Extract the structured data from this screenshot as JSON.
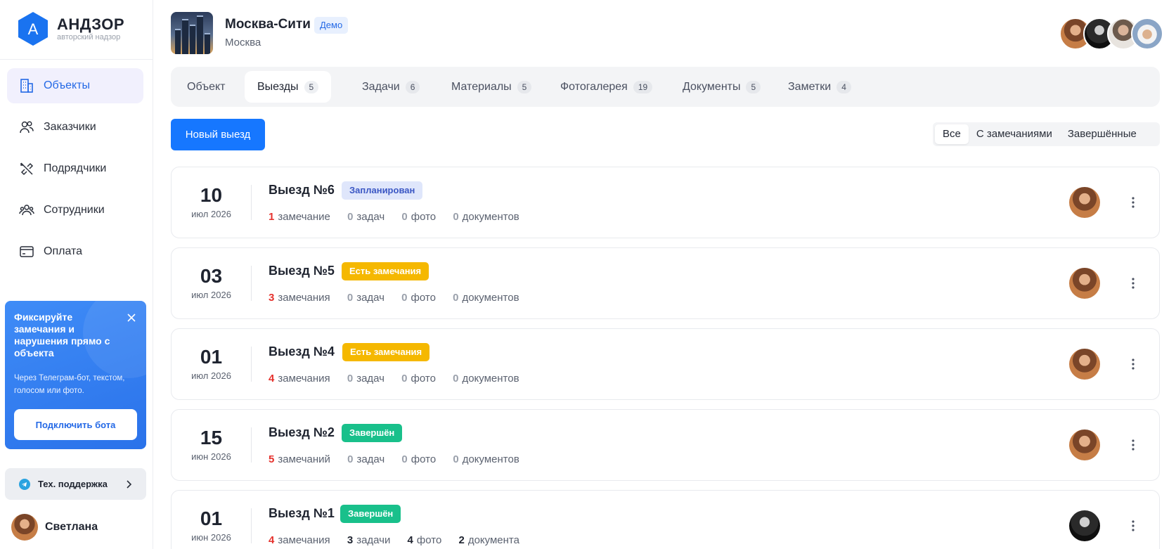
{
  "app": {
    "logo_letter": "A",
    "name": "АНДЗОР",
    "tagline": "авторский надзор"
  },
  "sidebar": {
    "items": [
      {
        "label": "Объекты",
        "icon": "building-icon",
        "active": true
      },
      {
        "label": "Заказчики",
        "icon": "users-icon"
      },
      {
        "label": "Подрядчики",
        "icon": "tools-icon"
      },
      {
        "label": "Сотрудники",
        "icon": "team-icon"
      },
      {
        "label": "Оплата",
        "icon": "card-icon"
      }
    ],
    "promo": {
      "title": "Фиксируйте замечания и нарушения прямо с объекта",
      "text": "Через Телеграм-бот, текстом, голосом или фото.",
      "button": "Подключить бота"
    },
    "support": "Тех. поддержка",
    "user": "Светлана"
  },
  "project": {
    "title": "Москва-Сити",
    "badge": "Демо",
    "city": "Москва"
  },
  "tabs": [
    {
      "label": "Объект",
      "count": ""
    },
    {
      "label": "Выезды",
      "count": "5",
      "active": true
    },
    {
      "label": "Задачи",
      "count": "6"
    },
    {
      "label": "Материалы",
      "count": "5"
    },
    {
      "label": "Фотогалерея",
      "count": "19"
    },
    {
      "label": "Документы",
      "count": "5"
    },
    {
      "label": "Заметки",
      "count": "4"
    }
  ],
  "actions": {
    "new_visit": "Новый выезд"
  },
  "filters": [
    {
      "label": "Все",
      "active": true
    },
    {
      "label": "С замечаниями"
    },
    {
      "label": "Завершённые"
    }
  ],
  "visits": [
    {
      "day": "10",
      "month": "июл 2026",
      "title": "Выезд №6",
      "status": "Запланирован",
      "status_kind": "planned",
      "remarks": "1",
      "remarks_label": "замечание",
      "tasks": "0",
      "tasks_label": "задач",
      "photos": "0",
      "photos_label": "фото",
      "docs": "0",
      "docs_label": "документов",
      "avatar": "woman"
    },
    {
      "day": "03",
      "month": "июл 2026",
      "title": "Выезд №5",
      "status": "Есть замечания",
      "status_kind": "issues",
      "remarks": "3",
      "remarks_label": "замечания",
      "tasks": "0",
      "tasks_label": "задач",
      "photos": "0",
      "photos_label": "фото",
      "docs": "0",
      "docs_label": "документов",
      "avatar": "woman"
    },
    {
      "day": "01",
      "month": "июл 2026",
      "title": "Выезд №4",
      "status": "Есть замечания",
      "status_kind": "issues",
      "remarks": "4",
      "remarks_label": "замечания",
      "tasks": "0",
      "tasks_label": "задач",
      "photos": "0",
      "photos_label": "фото",
      "docs": "0",
      "docs_label": "документов",
      "avatar": "woman"
    },
    {
      "day": "15",
      "month": "июн 2026",
      "title": "Выезд №2",
      "status": "Завершён",
      "status_kind": "done",
      "remarks": "5",
      "remarks_label": "замечаний",
      "tasks": "0",
      "tasks_label": "задач",
      "photos": "0",
      "photos_label": "фото",
      "docs": "0",
      "docs_label": "документов",
      "avatar": "woman"
    },
    {
      "day": "01",
      "month": "июн 2026",
      "title": "Выезд №1",
      "status": "Завершён",
      "status_kind": "done",
      "remarks": "4",
      "remarks_label": "замечания",
      "tasks": "3",
      "tasks_label": "задачи",
      "photos": "4",
      "photos_label": "фото",
      "docs": "2",
      "docs_label": "документа",
      "avatar": "dark"
    }
  ],
  "colors": {
    "accent": "#1677ff",
    "remark_red": "#e5322d",
    "planned_bg": "#dfe6fb",
    "issues_bg": "#f5b800",
    "done_bg": "#19c08b"
  }
}
